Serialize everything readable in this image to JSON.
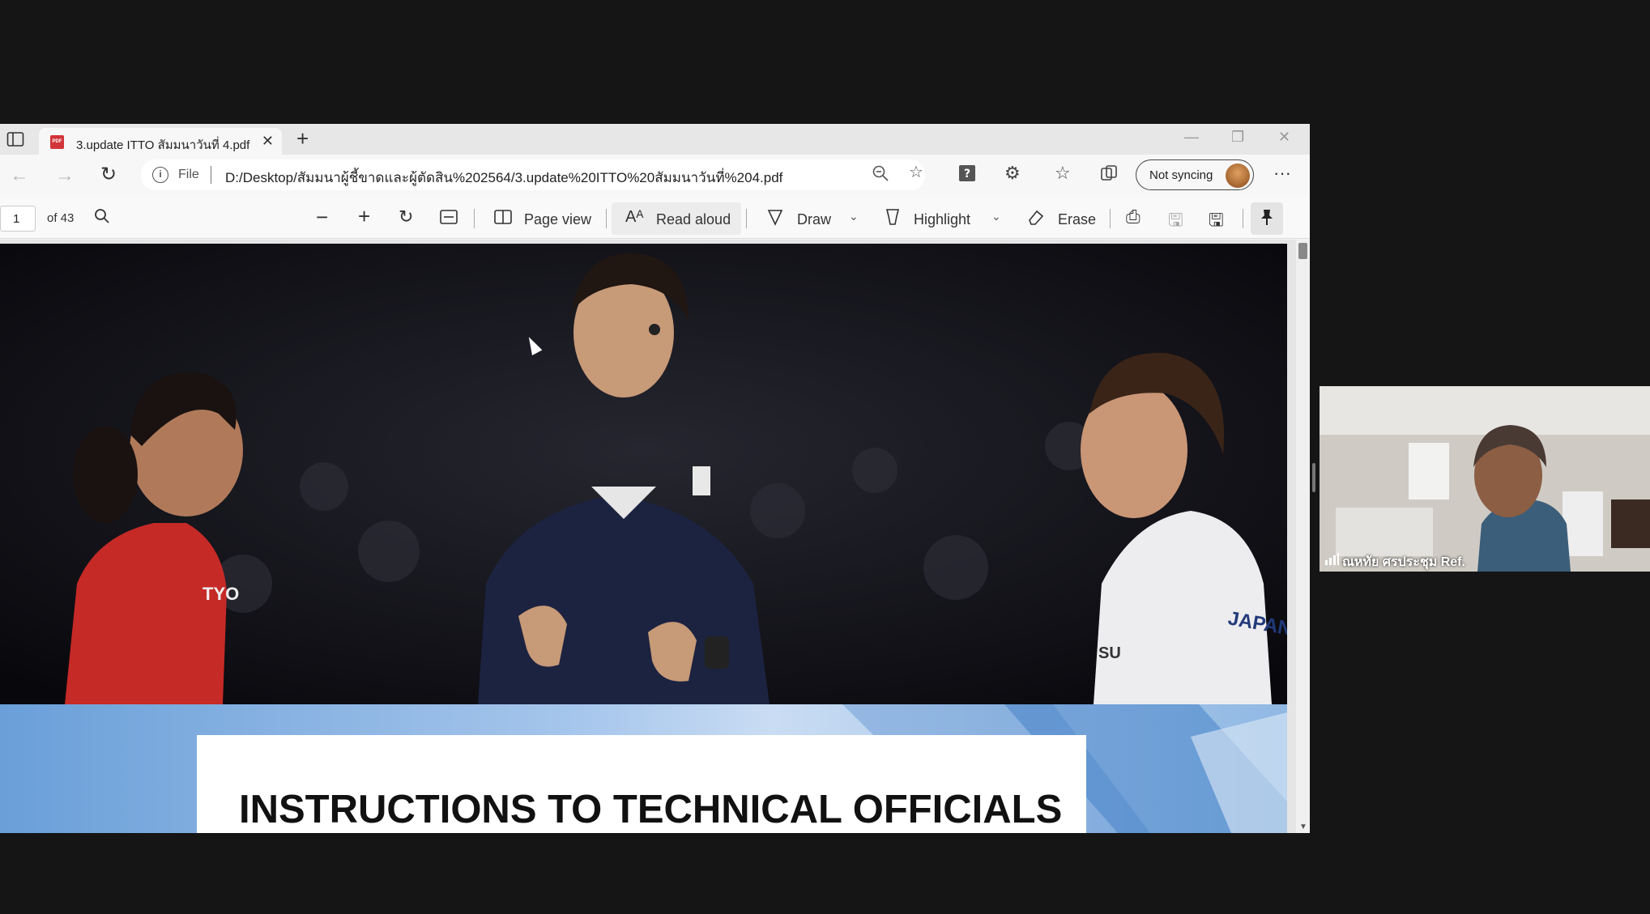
{
  "browser": {
    "tab": {
      "title": "3.update ITTO สัมมนาวันที่ 4.pdf",
      "pdf_badge": "PDF"
    },
    "address": {
      "scheme_label": "File",
      "url": "D:/Desktop/สัมมนาผู้ชี้ขาดและผู้ตัดสิน%202564/3.update%20ITTO%20สัมมนาวันที่%204.pdf"
    },
    "profile": {
      "sync_label": "Not syncing"
    }
  },
  "pdf_toolbar": {
    "page_number": "1",
    "page_total": "of 43",
    "page_view_label": "Page view",
    "read_aloud_label": "Read aloud",
    "draw_label": "Draw",
    "highlight_label": "Highlight",
    "erase_label": "Erase"
  },
  "pdf_page": {
    "banner_title": "INSTRUCTIONS TO TECHNICAL OFFICIALS",
    "jersey_left_text": "TYO",
    "jersey_right_text": "JAPAN",
    "jersey_right_side": "SU"
  },
  "video_tile": {
    "participant_name": "ณหทัย ศรประชุม Ref."
  },
  "colors": {
    "chrome_bg": "#f3f3f3",
    "banner_blue": "#8fb8e3",
    "jersey_red": "#d42a2a",
    "shirt_navy": "#1c2340",
    "pdf_red": "#d13438"
  }
}
